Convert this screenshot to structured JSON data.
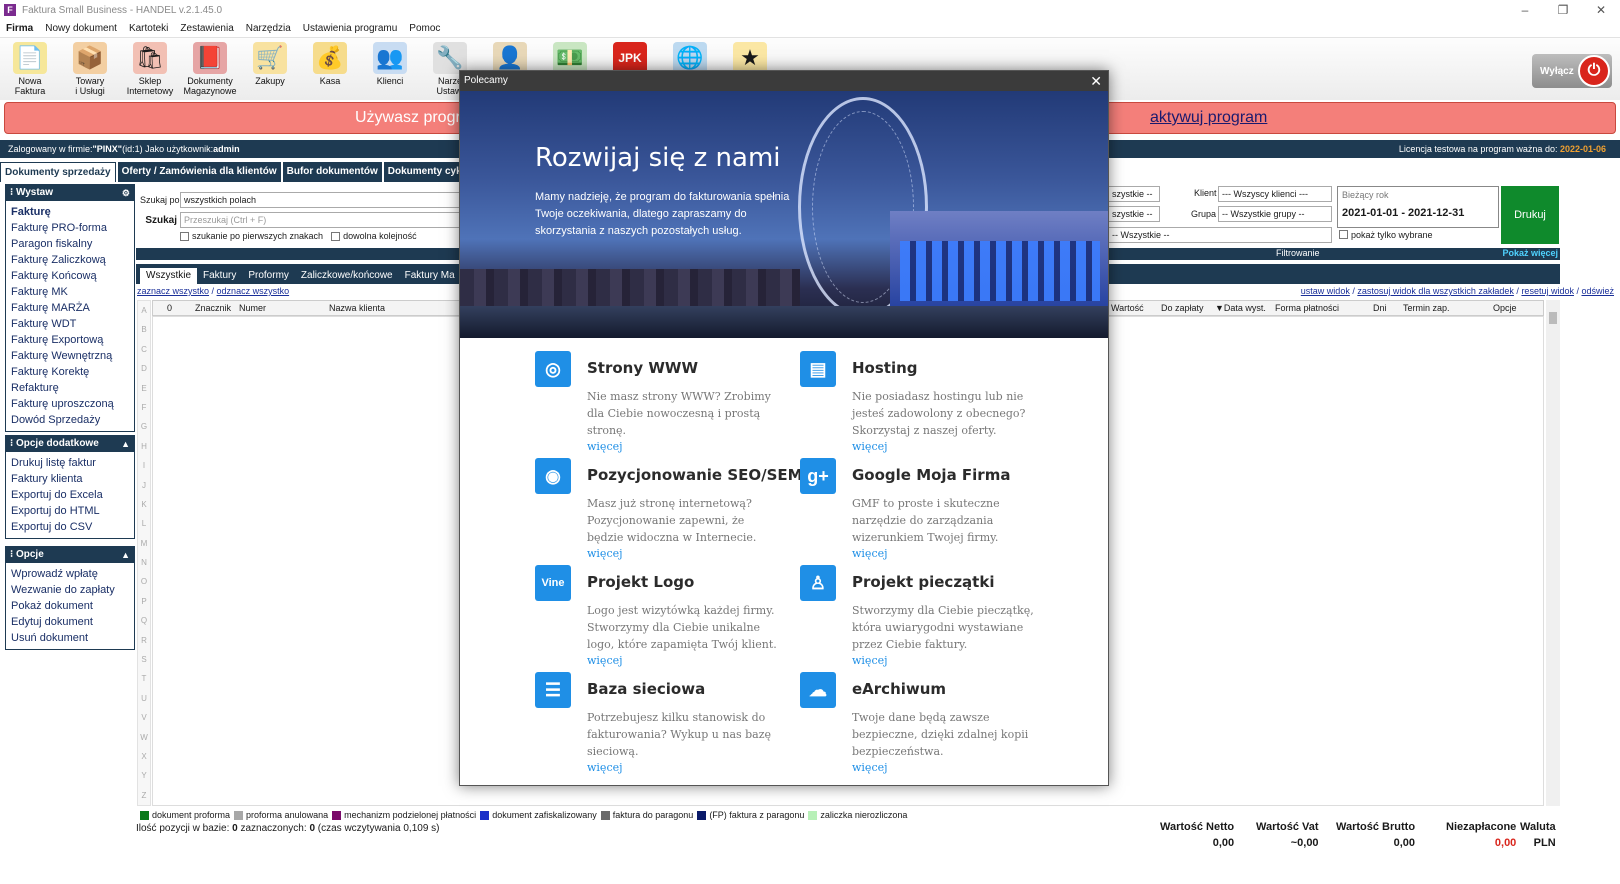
{
  "window": {
    "title": "Faktura Small Business - HANDEL v.2.1.45.0",
    "min": "–",
    "max": "❐",
    "close": "✕",
    "app_icon": "F"
  },
  "menu": [
    "Firma",
    "Nowy dokument",
    "Kartoteki",
    "Zestawienia",
    "Narzędzia",
    "Ustawienia programu",
    "Pomoc"
  ],
  "toolbar": [
    {
      "label": "Nowa\nFaktura",
      "icon": "invoice-icon",
      "glyph": "📄",
      "bg": "#f6e79a"
    },
    {
      "label": "Towary\ni Usługi",
      "icon": "boxes-icon",
      "glyph": "📦",
      "bg": "#f3cfa2"
    },
    {
      "label": "Sklep\nInternetowy",
      "icon": "shop-icon",
      "glyph": "🛍",
      "bg": "#f2c0b4"
    },
    {
      "label": "Dokumenty\nMagazynowe",
      "icon": "binder-icon",
      "glyph": "📕",
      "bg": "#e6a5a5"
    },
    {
      "label": "Zakupy",
      "icon": "cart-icon",
      "glyph": "🛒",
      "bg": "#f8e2a0"
    },
    {
      "label": "Kasa",
      "icon": "coins-icon",
      "glyph": "💰",
      "bg": "#f6dc8c"
    },
    {
      "label": "Klienci",
      "icon": "people-icon",
      "glyph": "👥",
      "bg": "#c8dcf2"
    },
    {
      "label": "Narzę\nUstawi",
      "icon": "tools-icon",
      "glyph": "🔧",
      "bg": "#e0e0e0"
    },
    {
      "label": "",
      "icon": "user-icon",
      "glyph": "👤",
      "bg": "#e8d8b8"
    },
    {
      "label": "",
      "icon": "money-icon",
      "glyph": "💵",
      "bg": "#c9e6c2"
    },
    {
      "label": "",
      "icon": "jpk-icon",
      "glyph": "JPK",
      "bg": "#d9251c"
    },
    {
      "label": "",
      "icon": "globe-icon",
      "glyph": "🌐",
      "bg": "#bcd9f0"
    },
    {
      "label": "",
      "icon": "star-icon",
      "glyph": "★",
      "bg": "#fbe7a4"
    }
  ],
  "power": {
    "label": "Wyłącz",
    "glyph": "⏻"
  },
  "banner": {
    "left": "Używasz program",
    "right": "aktywuj program"
  },
  "login": {
    "prefix": "Zalogowany w firmie: ",
    "firm": "\"PINX\"",
    "rest": " (id:1) Jako użytkownik: ",
    "user": "admin",
    "license_label": "Licencja testowa na program ważna do: ",
    "license_date": "2022-01-06"
  },
  "doc_tabs": [
    "Dokumenty sprzedaży",
    "Oferty / Zamówienia dla klientów",
    "Bufor dokumentów",
    "Dokumenty cyklicz"
  ],
  "panels": {
    "wystaw": {
      "title": "Wystaw",
      "items": [
        "Fakturę",
        "Fakturę PRO-forma",
        "Paragon fiskalny",
        "Fakturę Zaliczkową",
        "Fakturę Końcową",
        "Fakturę MK",
        "Fakturę MARŻA",
        "Fakturę WDT",
        "Fakturę Exportową",
        "Fakturę Wewnętrzną",
        "Fakturę Korektę",
        "Refakturę",
        "Fakturę uproszczoną",
        "Dowód Sprzedaży"
      ]
    },
    "opcje_dod": {
      "title": "Opcje dodatkowe",
      "items": [
        "Drukuj listę faktur",
        "Faktury klienta",
        "Exportuj do Excela",
        "Exportuj do HTML",
        "Exportuj do CSV"
      ]
    },
    "opcje": {
      "title": "Opcje",
      "items": [
        "Wprowadź wpłatę",
        "Wezwanie do zapłaty",
        "Pokaż dokument",
        "Edytuj dokument",
        "Usuń dokument"
      ]
    }
  },
  "search": {
    "by_label": "Szukaj po",
    "by_value": "wszystkich polach",
    "label": "Szukaj",
    "placeholder": "Przeszukaj (Ctrl + F)",
    "opt1": "szukanie po pierwszych znakach",
    "opt2": "dowolna kolejność"
  },
  "filters": {
    "sel1": "szystkie --",
    "sel2": "szystkie --",
    "sel3": "-- Wszystkie --",
    "klient_label": "Klient",
    "klient_value": "--- Wszyscy klienci ---",
    "grupa_label": "Grupa",
    "grupa_value": "-- Wszystkie grupy --",
    "only_selected": "pokaż tylko wybrane",
    "period_label": "Bieżący rok",
    "period_value": "2021-01-01 - 2021-12-31",
    "print": "Drukuj",
    "bar_label": "Filtrowanie",
    "more": "Pokaż więcej"
  },
  "grid_tabs": [
    "Wszystkie",
    "Faktury",
    "Proformy",
    "Zaliczkowe/końcowe",
    "Faktury Ma"
  ],
  "links": {
    "select_all": "zaznacz wszystko",
    "sep": " / ",
    "deselect_all": "odznacz wszystko",
    "right": [
      "ustaw widok",
      "zastosuj widok dla wszystkich zakładek",
      "resetuj widok",
      "odśwież"
    ]
  },
  "grid_headers_left": [
    "0",
    "Znacznik",
    "Numer",
    "Nazwa klienta"
  ],
  "grid_headers_right": [
    "Wartość",
    "Do zapłaty",
    "▼Data wyst.",
    "Forma płatności",
    "Dni",
    "Termin zap.",
    "Opcje"
  ],
  "alpha": [
    "A",
    "B",
    "C",
    "D",
    "E",
    "F",
    "G",
    "H",
    "I",
    "J",
    "K",
    "L",
    "M",
    "N",
    "O",
    "P",
    "Q",
    "R",
    "S",
    "T",
    "U",
    "V",
    "W",
    "X",
    "Y",
    "Z"
  ],
  "legend": [
    {
      "label": "dokument proforma",
      "color": "#0a7a1a"
    },
    {
      "label": "proforma anulowana",
      "color": "#a8a8a8"
    },
    {
      "label": "mechanizm podzielonej płatności",
      "color": "#7a0a6a"
    },
    {
      "label": "dokument zafiskalizowany",
      "color": "#1a2fc8"
    },
    {
      "label": "faktura do paragonu",
      "color": "#6a6a6a"
    },
    {
      "label": "(FP) faktura z paragonu",
      "color": "#0a1a6a"
    },
    {
      "label": "zaliczka nierozliczona",
      "color": "#b8f0b8"
    }
  ],
  "status": {
    "count_label": "Ilość pozycji w bazie: ",
    "count": "0",
    "selected_label": "  zaznaczonych: ",
    "selected": "0",
    "time": "  (czas wczytywania 0,109 s)"
  },
  "totals": [
    {
      "label": "Wartość Netto",
      "value": "0,00"
    },
    {
      "label": "Wartość Vat",
      "value": "~0,00"
    },
    {
      "label": "Wartość Brutto",
      "value": "0,00"
    },
    {
      "label": "Niezapłacone",
      "value": "0,00"
    },
    {
      "label": "Waluta",
      "value": "PLN"
    }
  ],
  "modal": {
    "title": "Polecamy",
    "close": "✕",
    "hero_title": "Rozwijaj się z nami",
    "hero_text": "Mamy nadzieję, że program do fakturowania spełnia Twoje oczekiwania, dlatego zapraszamy do skorzystania z naszych pozostałych usług.",
    "more": "więcej",
    "services": [
      {
        "title": "Strony WWW",
        "icon": "globe-icon",
        "glyph": "◎",
        "desc": "Nie masz strony WWW? Zrobimy dla Ciebie nowoczesną i prostą stronę."
      },
      {
        "title": "Hosting",
        "icon": "server-icon",
        "glyph": "▤",
        "desc": "Nie posiadasz hostingu lub nie jesteś zadowolony z obecnego? Skorzystaj z naszej oferty."
      },
      {
        "title": "Pozycjonowanie SEO/SEM",
        "icon": "target-icon",
        "glyph": "◉",
        "desc": "Masz już stronę internetową? Pozycjonowanie zapewni, że będzie widoczna w Internecie."
      },
      {
        "title": "Google Moja Firma",
        "icon": "google-plus-icon",
        "glyph": "g+",
        "desc": "GMF to proste i skuteczne narzędzie do zarządzania wizerunkiem Twojej firmy."
      },
      {
        "title": "Projekt Logo",
        "icon": "logo-icon",
        "glyph": "Vine",
        "desc": "Logo jest wizytówką każdej firmy. Stworzymy dla Ciebie unikalne logo, które zapamięta Twój klient."
      },
      {
        "title": "Projekt pieczątki",
        "icon": "stamp-icon",
        "glyph": "♙",
        "desc": "Stworzymy dla Ciebie pieczątkę, która uwiarygodni wystawiane przez Ciebie faktury."
      },
      {
        "title": "Baza sieciowa",
        "icon": "database-icon",
        "glyph": "☰",
        "desc": "Potrzebujesz kilku stanowisk do fakturowania? Wykup u nas bazę sieciową."
      },
      {
        "title": "eArchiwum",
        "icon": "cloud-icon",
        "glyph": "☁",
        "desc": "Twoje dane będą zawsze bezpieczne, dzięki zdalnej kopii bezpieczeństwa."
      }
    ]
  }
}
